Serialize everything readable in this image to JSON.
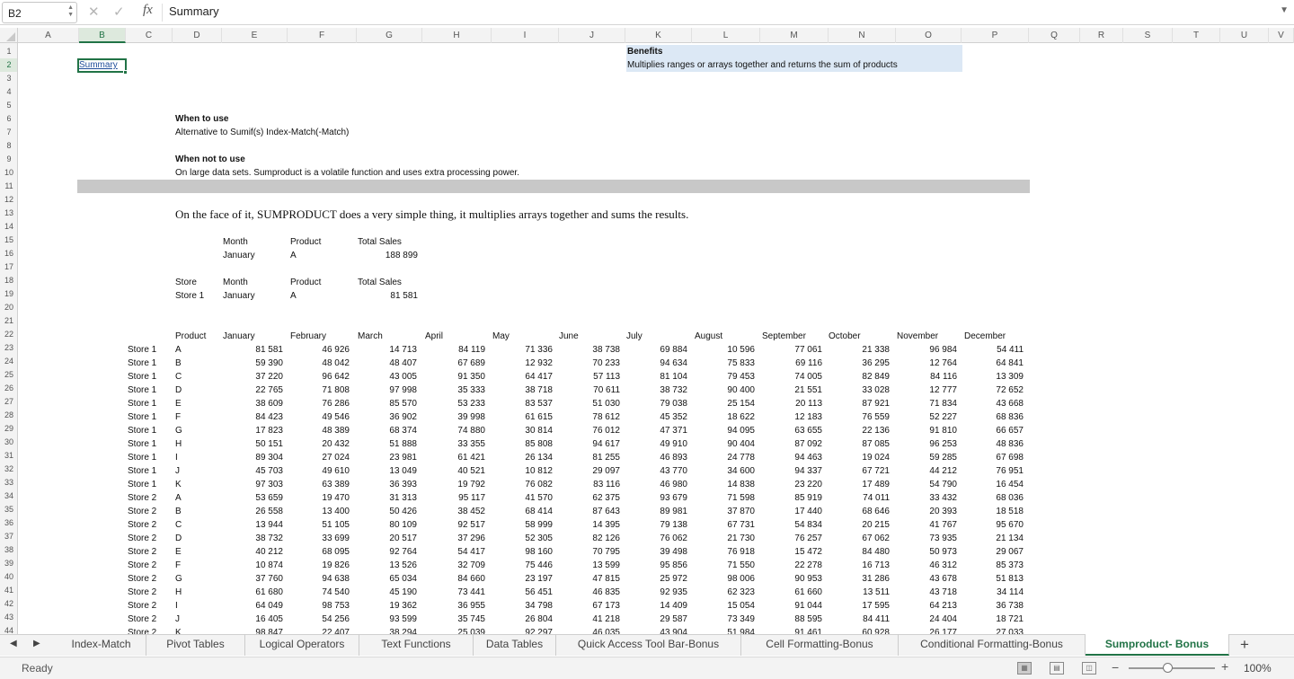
{
  "formula_bar": {
    "cell_ref": "B2",
    "fx_label": "fx",
    "content": "Summary",
    "cancel_glyph": "✕",
    "confirm_glyph": "✓",
    "expand_glyph": "▼"
  },
  "columns": [
    "A",
    "B",
    "C",
    "D",
    "E",
    "F",
    "G",
    "H",
    "I",
    "J",
    "K",
    "L",
    "M",
    "N",
    "O",
    "P",
    "Q",
    "R",
    "S",
    "T",
    "U",
    "V"
  ],
  "selected_column": "B",
  "rows": [
    "1",
    "2",
    "3",
    "4",
    "5",
    "6",
    "7",
    "8",
    "9",
    "10",
    "11",
    "12",
    "13",
    "14",
    "15",
    "16",
    "17",
    "18",
    "19",
    "20",
    "21",
    "22",
    "23",
    "24",
    "25",
    "26",
    "27",
    "28",
    "29",
    "30",
    "31",
    "32",
    "33",
    "34",
    "35",
    "36",
    "37",
    "38",
    "39",
    "40",
    "41",
    "42",
    "43",
    "44"
  ],
  "selected_row": "2",
  "cells": {
    "summary_link": "Summary",
    "benefits_title": "Benefits",
    "benefits_text": "Multiplies ranges or arrays together and returns the sum of products",
    "when_to_use": "When to use",
    "when_to_use_text": "Alternative to Sumif(s) Index-Match(-Match)",
    "when_not_to_use": "When not to use",
    "when_not_to_use_text": "On large data sets. Sumproduct is a volatile function and uses extra processing power.",
    "intro": "On the face of it, SUMPRODUCT does a very simple thing, it multiplies arrays together and sums the results.",
    "example1": {
      "month_h": "Month",
      "product_h": "Product",
      "total_h": "Total Sales",
      "month": "January",
      "product": "A",
      "total": "188 899"
    },
    "example2": {
      "store_h": "Store",
      "month_h": "Month",
      "product_h": "Product",
      "total_h": "Total Sales",
      "store": "Store 1",
      "month": "January",
      "product": "A",
      "total": "81 581"
    }
  },
  "table": {
    "headers": [
      "Product",
      "January",
      "February",
      "March",
      "April",
      "May",
      "June",
      "July",
      "August",
      "September",
      "October",
      "November",
      "December"
    ],
    "rows": [
      [
        "Store 1",
        "A",
        "81 581",
        "46 926",
        "14 713",
        "84 119",
        "71 336",
        "38 738",
        "69 884",
        "10 596",
        "77 061",
        "21 338",
        "96 984",
        "54 411"
      ],
      [
        "Store 1",
        "B",
        "59 390",
        "48 042",
        "48 407",
        "67 689",
        "12 932",
        "70 233",
        "94 634",
        "75 833",
        "69 116",
        "36 295",
        "12 764",
        "64 841"
      ],
      [
        "Store 1",
        "C",
        "37 220",
        "96 642",
        "43 005",
        "91 350",
        "64 417",
        "57 113",
        "81 104",
        "79 453",
        "74 005",
        "82 849",
        "84 116",
        "13 309"
      ],
      [
        "Store 1",
        "D",
        "22 765",
        "71 808",
        "97 998",
        "35 333",
        "38 718",
        "70 611",
        "38 732",
        "90 400",
        "21 551",
        "33 028",
        "12 777",
        "72 652"
      ],
      [
        "Store 1",
        "E",
        "38 609",
        "76 286",
        "85 570",
        "53 233",
        "83 537",
        "51 030",
        "79 038",
        "25 154",
        "20 113",
        "87 921",
        "71 834",
        "43 668"
      ],
      [
        "Store 1",
        "F",
        "84 423",
        "49 546",
        "36 902",
        "39 998",
        "61 615",
        "78 612",
        "45 352",
        "18 622",
        "12 183",
        "76 559",
        "52 227",
        "68 836"
      ],
      [
        "Store 1",
        "G",
        "17 823",
        "48 389",
        "68 374",
        "74 880",
        "30 814",
        "76 012",
        "47 371",
        "94 095",
        "63 655",
        "22 136",
        "91 810",
        "66 657"
      ],
      [
        "Store 1",
        "H",
        "50 151",
        "20 432",
        "51 888",
        "33 355",
        "85 808",
        "94 617",
        "49 910",
        "90 404",
        "87 092",
        "87 085",
        "96 253",
        "48 836"
      ],
      [
        "Store 1",
        "I",
        "89 304",
        "27 024",
        "23 981",
        "61 421",
        "26 134",
        "81 255",
        "46 893",
        "24 778",
        "94 463",
        "19 024",
        "59 285",
        "67 698"
      ],
      [
        "Store 1",
        "J",
        "45 703",
        "49 610",
        "13 049",
        "40 521",
        "10 812",
        "29 097",
        "43 770",
        "34 600",
        "94 337",
        "67 721",
        "44 212",
        "76 951"
      ],
      [
        "Store 1",
        "K",
        "97 303",
        "63 389",
        "36 393",
        "19 792",
        "76 082",
        "83 116",
        "46 980",
        "14 838",
        "23 220",
        "17 489",
        "54 790",
        "16 454"
      ],
      [
        "Store 2",
        "A",
        "53 659",
        "19 470",
        "31 313",
        "95 117",
        "41 570",
        "62 375",
        "93 679",
        "71 598",
        "85 919",
        "74 011",
        "33 432",
        "68 036"
      ],
      [
        "Store 2",
        "B",
        "26 558",
        "13 400",
        "50 426",
        "38 452",
        "68 414",
        "87 643",
        "89 981",
        "37 870",
        "17 440",
        "68 646",
        "20 393",
        "18 518"
      ],
      [
        "Store 2",
        "C",
        "13 944",
        "51 105",
        "80 109",
        "92 517",
        "58 999",
        "14 395",
        "79 138",
        "67 731",
        "54 834",
        "20 215",
        "41 767",
        "95 670"
      ],
      [
        "Store 2",
        "D",
        "38 732",
        "33 699",
        "20 517",
        "37 296",
        "52 305",
        "82 126",
        "76 062",
        "21 730",
        "76 257",
        "67 062",
        "73 935",
        "21 134"
      ],
      [
        "Store 2",
        "E",
        "40 212",
        "68 095",
        "92 764",
        "54 417",
        "98 160",
        "70 795",
        "39 498",
        "76 918",
        "15 472",
        "84 480",
        "50 973",
        "29 067"
      ],
      [
        "Store 2",
        "F",
        "10 874",
        "19 826",
        "13 526",
        "32 709",
        "75 446",
        "13 599",
        "95 856",
        "71 550",
        "22 278",
        "16 713",
        "46 312",
        "85 373"
      ],
      [
        "Store 2",
        "G",
        "37 760",
        "94 638",
        "65 034",
        "84 660",
        "23 197",
        "47 815",
        "25 972",
        "98 006",
        "90 953",
        "31 286",
        "43 678",
        "51 813"
      ],
      [
        "Store 2",
        "H",
        "61 680",
        "74 540",
        "45 190",
        "73 441",
        "56 451",
        "46 835",
        "92 935",
        "62 323",
        "61 660",
        "13 511",
        "43 718",
        "34 114"
      ],
      [
        "Store 2",
        "I",
        "64 049",
        "98 753",
        "19 362",
        "36 955",
        "34 798",
        "67 173",
        "14 409",
        "15 054",
        "91 044",
        "17 595",
        "64 213",
        "36 738"
      ],
      [
        "Store 2",
        "J",
        "16 405",
        "54 256",
        "93 599",
        "35 745",
        "26 804",
        "41 218",
        "29 587",
        "73 349",
        "88 595",
        "84 411",
        "24 404",
        "18 721"
      ],
      [
        "Store 2",
        "K",
        "98 847",
        "22 407",
        "38 294",
        "25 039",
        "92 297",
        "46 035",
        "43 904",
        "51 984",
        "91 461",
        "60 928",
        "26 177",
        "27 033"
      ]
    ]
  },
  "sheet_tabs": [
    "Index-Match",
    "Pivot Tables",
    "Logical Operators",
    "Text Functions",
    "Data Tables",
    "Quick Access Tool Bar-Bonus",
    "Cell Formatting-Bonus",
    "Conditional Formatting-Bonus",
    "Sumproduct- Bonus"
  ],
  "active_tab": "Sumproduct- Bonus",
  "add_tab": "+",
  "status": {
    "ready": "Ready",
    "zoom": "100%",
    "zoom_minus": "−",
    "zoom_plus": "+",
    "zoom_fraction": 0.45
  },
  "colors": {
    "accent": "#217346",
    "benefits_bg": "#dce8f5",
    "band": "#c8c8c8",
    "link": "#1f4e9a"
  }
}
